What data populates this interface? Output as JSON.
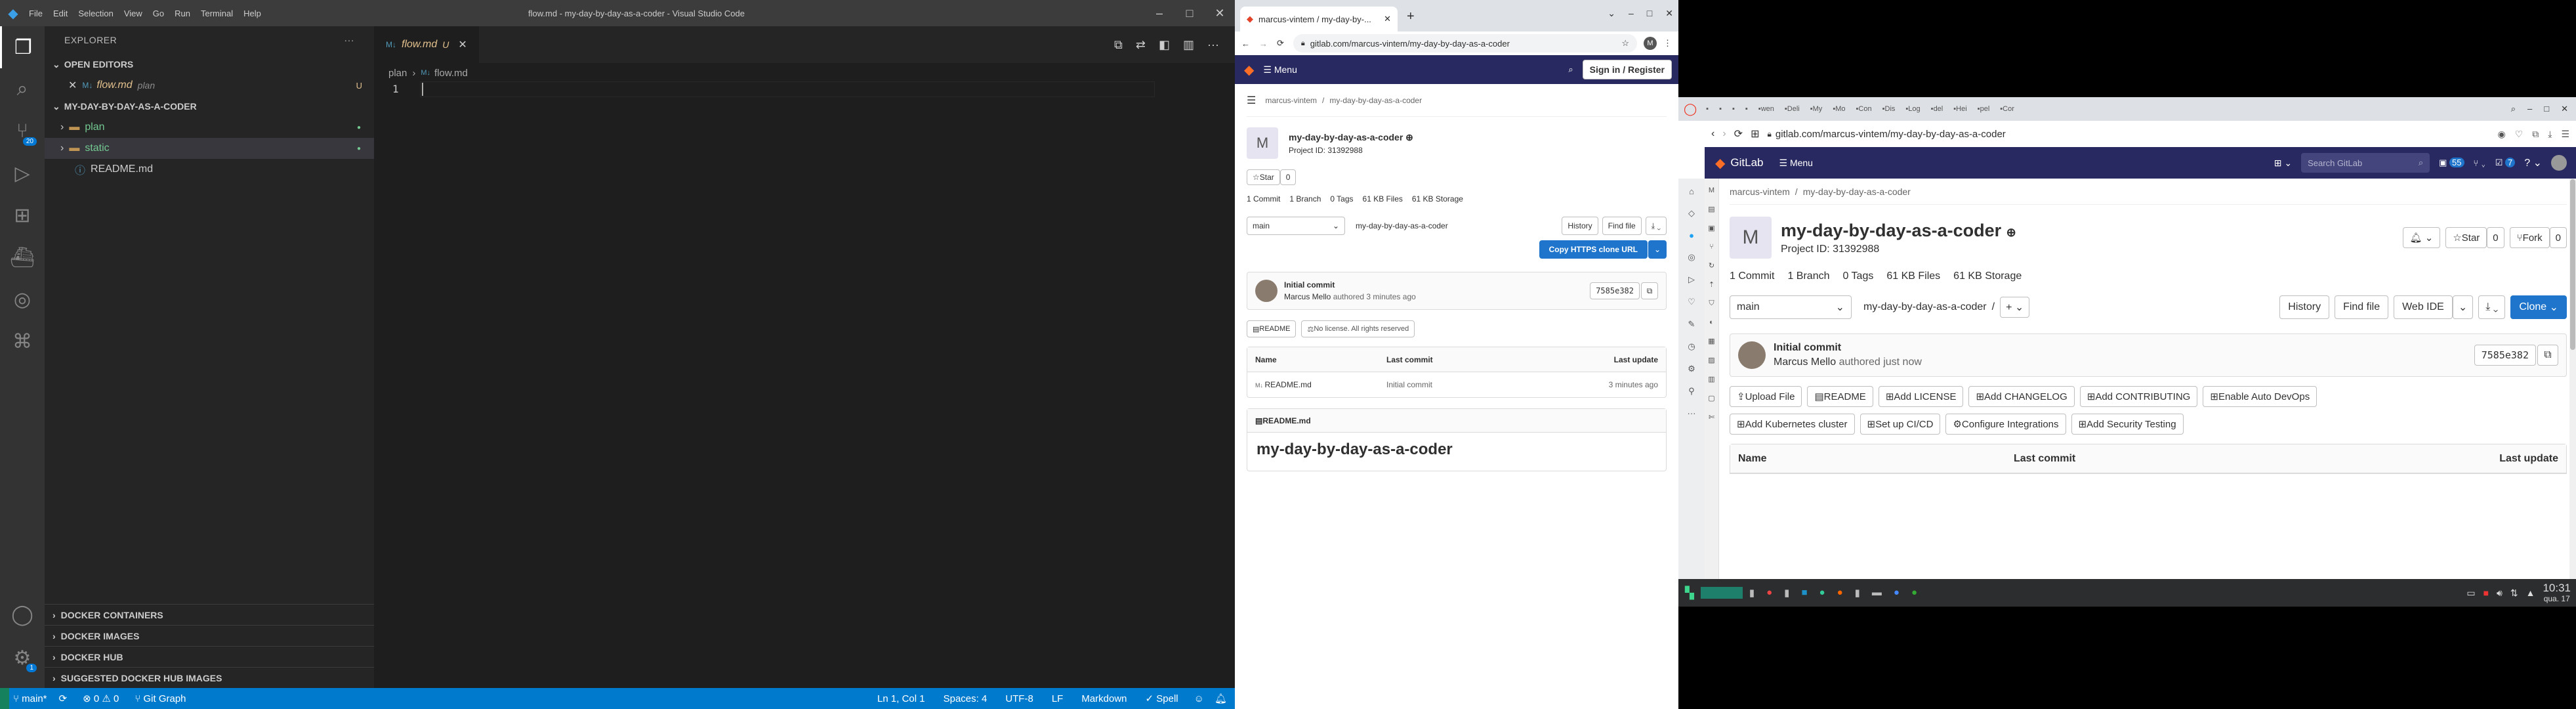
{
  "vscode": {
    "window_title": "flow.md - my-day-by-day-as-a-coder - Visual Studio Code",
    "menu": [
      "File",
      "Edit",
      "Selection",
      "View",
      "Go",
      "Run",
      "Terminal",
      "Help"
    ],
    "explorer_title": "EXPLORER",
    "open_editors": "OPEN EDITORS",
    "open_file": "flow.md",
    "open_file_dir": "plan",
    "open_file_status": "U",
    "folder_name": "MY-DAY-BY-DAY-AS-A-CODER",
    "tree": [
      {
        "name": "plan",
        "type": "folder"
      },
      {
        "name": "static",
        "type": "folder"
      },
      {
        "name": "README.md",
        "type": "file"
      }
    ],
    "scm_badge": "20",
    "bottom_sections": [
      "DOCKER CONTAINERS",
      "DOCKER IMAGES",
      "DOCKER HUB",
      "SUGGESTED DOCKER HUB IMAGES"
    ],
    "tab_label": "flow.md",
    "tab_status": "U",
    "breadcrumb": [
      "plan",
      "flow.md"
    ],
    "line_number": "1",
    "status": {
      "branch": "main*",
      "problems": "⊗ 0 ⚠ 0",
      "git_graph": "Git Graph",
      "position": "Ln 1, Col 1",
      "spaces": "Spaces: 4",
      "encoding": "UTF-8",
      "eol": "LF",
      "language": "Markdown",
      "spell": "✓ Spell"
    },
    "settings_badge": "1"
  },
  "browser1": {
    "tab_title": "marcus-vintem / my-day-by-...",
    "url": "gitlab.com/marcus-vintem/my-day-by-day-as-a-coder",
    "menu_label": "Menu",
    "signin": "Sign in / Register",
    "breadcrumb": [
      "marcus-vintem",
      "my-day-by-day-as-a-coder"
    ],
    "avatar_letter": "M",
    "project_name": "my-day-by-day-as-a-coder",
    "project_id": "Project ID: 31392988",
    "star": "Star",
    "star_count": "0",
    "stats": [
      "1 Commit",
      "1 Branch",
      "0 Tags",
      "61 KB Files",
      "61 KB Storage"
    ],
    "branch": "main",
    "path": "my-day-by-day-as-a-coder",
    "history": "History",
    "find_file": "Find file",
    "clone": "Copy HTTPS clone URL",
    "commit_title": "Initial commit",
    "commit_author": "Marcus Mello",
    "commit_time": "authored 3 minutes ago",
    "commit_sha": "7585e382",
    "readme_badge": "README",
    "license_badge": "No license. All rights reserved",
    "table_headers": [
      "Name",
      "Last commit",
      "Last update"
    ],
    "file_row": {
      "name": "README.md",
      "commit": "Initial commit",
      "update": "3 minutes ago"
    },
    "readme_header": "README.md",
    "readme_title": "my-day-by-day-as-a-coder"
  },
  "browser2": {
    "url": "gitlab.com/marcus-vintem/my-day-by-day-as-a-coder",
    "tabs": [
      "",
      "",
      "",
      "",
      "wen",
      "Deli",
      "My",
      "Mo",
      "Con",
      "Dis",
      "Log",
      "del",
      "Hei",
      "pel",
      "Cor"
    ],
    "brand": "GitLab",
    "menu_label": "Menu",
    "search_placeholder": "Search GitLab",
    "issues_count": "55",
    "mr_count": "7",
    "breadcrumb": [
      "marcus-vintem",
      "my-day-by-day-as-a-coder"
    ],
    "avatar_letter": "M",
    "project_name": "my-day-by-day-as-a-coder",
    "project_id": "Project ID: 31392988",
    "star": "Star",
    "star_count": "0",
    "fork": "Fork",
    "fork_count": "0",
    "stats": [
      "1 Commit",
      "1 Branch",
      "0 Tags",
      "61 KB Files",
      "61 KB Storage"
    ],
    "branch": "main",
    "path": "my-day-by-day-as-a-coder",
    "history": "History",
    "find_file": "Find file",
    "web_ide": "Web IDE",
    "clone": "Clone",
    "commit_title": "Initial commit",
    "commit_author": "Marcus Mello",
    "commit_time": "authored just now",
    "commit_sha": "7585e382",
    "actions_row1": [
      "Upload File",
      "README",
      "Add LICENSE",
      "Add CHANGELOG",
      "Add CONTRIBUTING",
      "Enable Auto DevOps"
    ],
    "actions_row2": [
      "Add Kubernetes cluster",
      "Set up CI/CD",
      "Configure Integrations",
      "Add Security Testing"
    ],
    "table_headers": [
      "Name",
      "Last commit",
      "Last update"
    ]
  },
  "taskbar": {
    "time": "10:31",
    "date": "qua. 17"
  },
  "colors": {
    "vscode_status": "#007acc",
    "gitlab_nav": "#292961",
    "gitlab_blue": "#1f75cb"
  }
}
